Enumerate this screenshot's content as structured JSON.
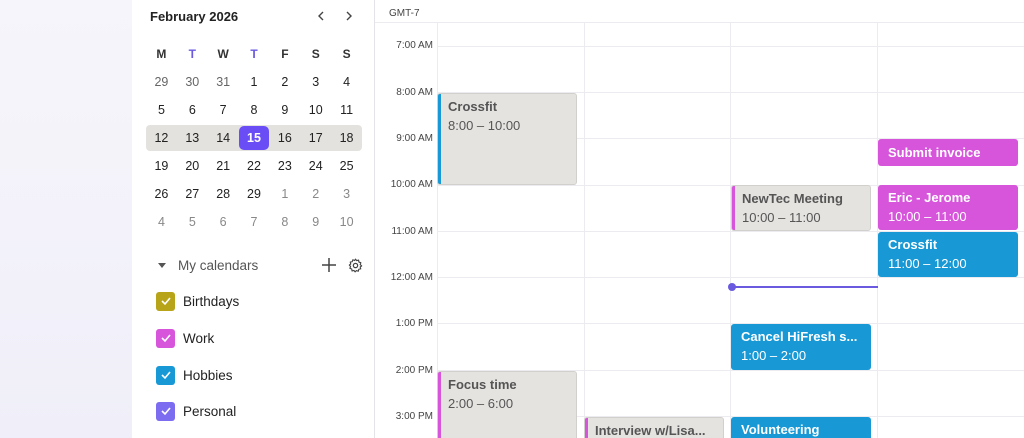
{
  "mini_calendar": {
    "month_label": "February 2026",
    "prev_icon": "chevron-left-icon",
    "next_icon": "chevron-right-icon",
    "weekdays": [
      "M",
      "T",
      "W",
      "T",
      "F",
      "S",
      "S"
    ],
    "weeks": [
      [
        "29",
        "30",
        "31",
        "1",
        "2",
        "3",
        "4"
      ],
      [
        "5",
        "6",
        "7",
        "8",
        "9",
        "10",
        "11"
      ],
      [
        "12",
        "13",
        "14",
        "15",
        "16",
        "17",
        "18"
      ],
      [
        "19",
        "20",
        "21",
        "22",
        "23",
        "24",
        "25"
      ],
      [
        "26",
        "27",
        "28",
        "29",
        "1",
        "2",
        "3"
      ],
      [
        "4",
        "5",
        "6",
        "7",
        "8",
        "9",
        "10"
      ]
    ],
    "today": "15"
  },
  "my_calendars": {
    "title": "My calendars",
    "add_icon": "plus-icon",
    "settings_icon": "gear-icon",
    "items": [
      {
        "label": "Birthdays",
        "color": "#b8a418"
      },
      {
        "label": "Work",
        "color": "#d655db"
      },
      {
        "label": "Hobbies",
        "color": "#1899d6"
      },
      {
        "label": "Personal",
        "color": "#7b6cf0"
      }
    ]
  },
  "schedule": {
    "timezone": "GMT-7",
    "hours": [
      "7:00 AM",
      "8:00 AM",
      "9:00 AM",
      "10:00 AM",
      "11:00 AM",
      "12:00 AM",
      "1:00 PM",
      "2:00 PM",
      "3:00 PM"
    ],
    "events": [
      {
        "title": "Crossfit",
        "time": "8:00 – 10:00",
        "style": "gray",
        "stripe": "#1899d6"
      },
      {
        "title": "Focus time",
        "time": "2:00 – 6:00",
        "style": "gray",
        "stripe": "#d655db"
      },
      {
        "title": "Interview w/Lisa...",
        "time": "",
        "style": "gray",
        "stripe": "#d655db"
      },
      {
        "title": "NewTec Meeting",
        "time": "10:00 – 11:00",
        "style": "gray",
        "stripe": "#d655db"
      },
      {
        "title": "Cancel HiFresh s...",
        "time": "1:00 – 2:00",
        "style": "blue",
        "stripe": ""
      },
      {
        "title": "Volunteering",
        "time": "",
        "style": "blue",
        "stripe": ""
      },
      {
        "title": "Submit invoice",
        "time": "",
        "style": "magenta",
        "stripe": ""
      },
      {
        "title": "Eric - Jerome",
        "time": "10:00 – 11:00",
        "style": "magenta",
        "stripe": ""
      },
      {
        "title": "Crossfit",
        "time": "11:00 – 12:00",
        "style": "blue",
        "stripe": ""
      }
    ],
    "now_indicator_color": "#6a5ae0"
  }
}
